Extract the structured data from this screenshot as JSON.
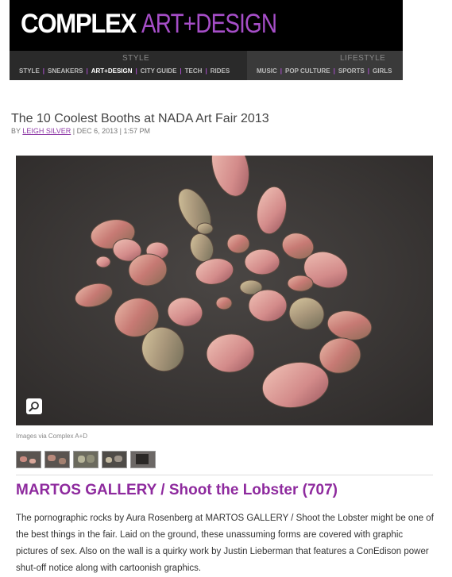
{
  "header": {
    "logo_primary": "COMPLEX",
    "logo_secondary": "ART+DESIGN",
    "style_caption": "STYLE",
    "lifestyle_caption": "LIFESTYLE",
    "style_nav": [
      "STYLE",
      "SNEAKERS",
      "ART+DESIGN",
      "CITY GUIDE",
      "TECH",
      "RIDES"
    ],
    "lifestyle_nav": [
      "MUSIC",
      "POP CULTURE",
      "SPORTS",
      "GIRLS"
    ],
    "active_item": "ART+DESIGN"
  },
  "article": {
    "title": "The 10 Coolest Booths at NADA Art Fair 2013",
    "by_prefix": "BY",
    "author": "LEIGH SILVER",
    "date": "| DEC 6, 2013 | 1:57 PM",
    "image_caption": "Images via Complex A+D",
    "section_heading": "MARTOS GALLERY / Shoot the Lobster (707)",
    "body": "The pornographic rocks by Aura Rosenberg at MARTOS GALLERY / Shoot the Lobster might be one of the best things in the fair. Laid on the ground, these unassuming forms are covered with graphic pictures of sex. Also on the wall is a quirky work by Justin Lieberman that features a ConEdison power shut-off notice along with cartoonish graphics."
  },
  "colors": {
    "accent_purple": "#8e2a9e",
    "logo_purple": "#a64ec8",
    "header_bg": "#000000"
  },
  "icons": {
    "zoom": "magnifier-icon"
  }
}
